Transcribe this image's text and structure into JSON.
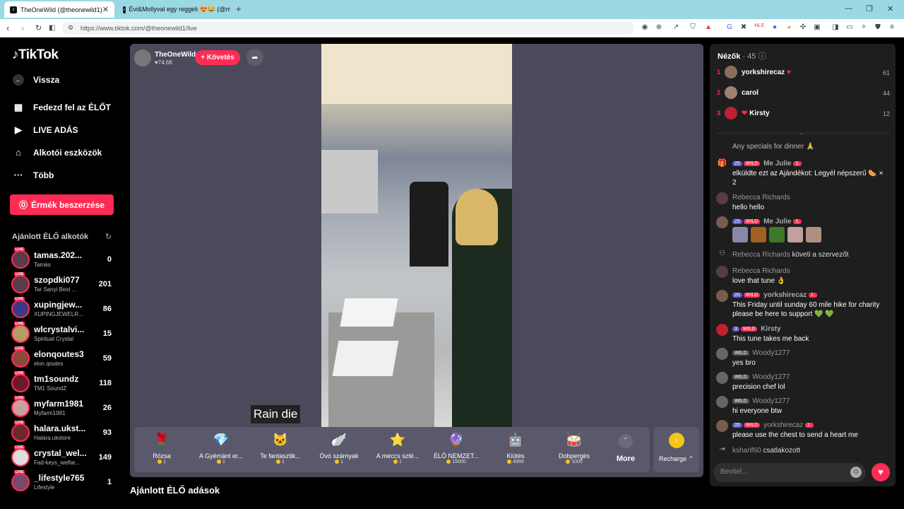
{
  "browser": {
    "tabs": [
      {
        "title": "TheOneWild (@theonewild1)"
      },
      {
        "title": "Évi&Mollyval egy reggeli 😍😂 (@m"
      }
    ],
    "url": "https://www.tiktok.com/@theonewild1/live"
  },
  "sidebar": {
    "logo": "TikTok",
    "back": "Vissza",
    "menu": [
      {
        "label": "Fedezd fel az ÉLŐT",
        "icon": "calendar-icon"
      },
      {
        "label": "LIVE ADÁS",
        "icon": "camera-icon"
      },
      {
        "label": "Alkotói eszközök",
        "icon": "home-icon"
      },
      {
        "label": "Több",
        "icon": "dots-icon"
      }
    ],
    "buy_button": "Érmék beszerzése",
    "recommended_title": "Ajánlott ÉLŐ alkotók",
    "creators": [
      {
        "name": "tamas.202...",
        "sub": "Tamás",
        "count": "0"
      },
      {
        "name": "szopdki077",
        "sub": "Tar Sanyi Best ...",
        "count": "201"
      },
      {
        "name": "xupingjew...",
        "sub": "XUPINGJEWELR...",
        "count": "86"
      },
      {
        "name": "wlcrystalvi...",
        "sub": "Spiritual Crystal",
        "count": "15"
      },
      {
        "name": "elonqoutes3",
        "sub": "elon qoutes",
        "count": "59"
      },
      {
        "name": "tm1soundz",
        "sub": "TM1 SoundZ",
        "count": "118"
      },
      {
        "name": "myfarm1981",
        "sub": "Myfarm1981",
        "count": "26"
      },
      {
        "name": "halara.ukst...",
        "sub": "Halara.ukstore",
        "count": "93"
      },
      {
        "name": "crystal_wel...",
        "sub": "Fad-keys_welfar...",
        "count": "149"
      },
      {
        "name": "_lifestyle765",
        "sub": "Lifestyle",
        "count": "1"
      }
    ],
    "live_badge": "LIVE"
  },
  "stream": {
    "host": "TheOneWild",
    "likes": "74.6K",
    "follow": "+ Követés",
    "caption": "Rain die",
    "recommended_title": "Ajánlott ÉLŐ adások"
  },
  "gifts": [
    {
      "name": "Rózsa",
      "price": "1",
      "icon": "🌹"
    },
    {
      "name": "A Gyémánt er...",
      "price": "1",
      "icon": "💎"
    },
    {
      "name": "Te fantasztik...",
      "price": "1",
      "icon": "🐱"
    },
    {
      "name": "Óvó szárnyak",
      "price": "1",
      "icon": "🪽"
    },
    {
      "name": "A meccs szté...",
      "price": "1",
      "icon": "⭐"
    },
    {
      "name": "ÉLŐ NEMZET...",
      "price": "15000",
      "icon": "🔮"
    },
    {
      "name": "Kiütés",
      "price": "4999",
      "icon": "🤖"
    },
    {
      "name": "Dobpergés",
      "price": "1000",
      "icon": "🥁"
    }
  ],
  "more_label": "More",
  "recharge_label": "Recharge",
  "chat": {
    "viewers_label": "Nézők",
    "viewers_count": "· 45",
    "top_viewers": [
      {
        "rank": "1",
        "name": "yorkshirecaz",
        "score": "61"
      },
      {
        "rank": "2",
        "name": "carol",
        "score": "44"
      },
      {
        "rank": "3",
        "name": "Kirsty",
        "score": "12"
      }
    ],
    "messages": [
      {
        "user": "",
        "text": "Any specials for dinner 🙏"
      },
      {
        "user": "Me Julie",
        "level": "25",
        "text": "elküldte ezt az Ajándékot: Legyél népszerű 🌭 × 2"
      },
      {
        "user": "Rebecca Richards",
        "text": "hello hello"
      },
      {
        "user": "Me Julie",
        "level": "25",
        "text": ""
      },
      {
        "user": "Rebecca Richards",
        "text": "követi a szervezőt"
      },
      {
        "user": "Rebecca Richards",
        "text": "love that tune 👌"
      },
      {
        "user": "yorkshirecaz",
        "level": "20",
        "text": "This Friday until sunday 60 mile hike for charity please be here to support 💚 💚"
      },
      {
        "user": "Kirsty",
        "level": "3",
        "text": "This tune takes me back"
      },
      {
        "user": "Woody1277",
        "text": "yes bro"
      },
      {
        "user": "Woody1277",
        "text": "precision chef lol"
      },
      {
        "user": "Woody1277",
        "text": "hi everyone btw"
      },
      {
        "user": "yorkshirecaz",
        "level": "20",
        "text": "please use the chest to send a heart me"
      },
      {
        "user": "ksharif60",
        "text": "csatlakozott"
      }
    ],
    "input_placeholder": "Bevitel...",
    "wild_badge": "WILD",
    "rank_badge": "1."
  }
}
